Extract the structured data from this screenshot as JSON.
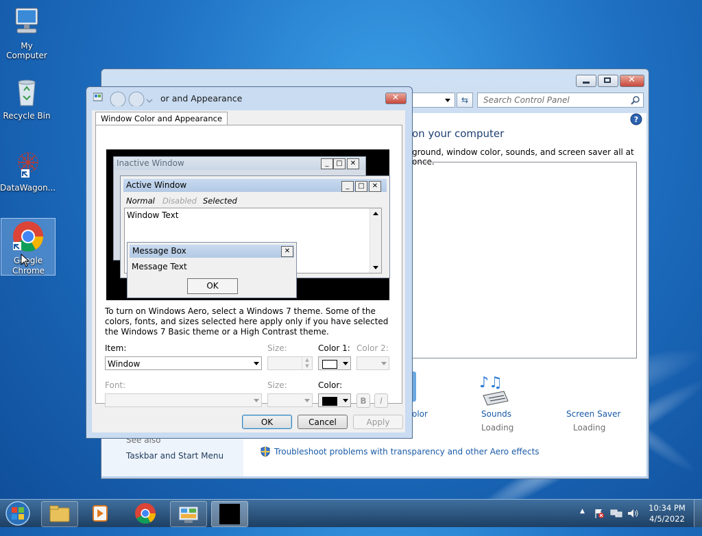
{
  "desktop": {
    "icons": [
      {
        "label": "My Computer"
      },
      {
        "label": "Recycle Bin"
      },
      {
        "label": "DataWagon..."
      },
      {
        "label": "Google Chrome"
      }
    ]
  },
  "control_panel": {
    "search_placeholder": "Search Control Panel",
    "heading_fragment": "on your computer",
    "description_fragment": "ground, window color, sounds, and screen saver all at once.",
    "color_fragment": "olor",
    "sounds_label": "Sounds",
    "sounds_status": "Loading",
    "screensaver_label": "Screen Saver",
    "screensaver_status": "Loading",
    "see_also": "See also",
    "taskbar_link": "Taskbar and Start Menu",
    "troubleshoot_link": "Troubleshoot problems with transparency and other Aero effects"
  },
  "dialog": {
    "title": "Window Color and Appearance",
    "title_visible": "or and Appearance",
    "tab_label": "Window Color and Appearance",
    "preview": {
      "inactive_title": "Inactive Window",
      "active_title": "Active Window",
      "menu_normal": "Normal",
      "menu_disabled": "Disabled",
      "menu_selected": "Selected",
      "window_text": "Window Text",
      "msgbox_title": "Message Box",
      "msgbox_text": "Message Text",
      "msgbox_ok": "OK"
    },
    "info_text": "To turn on Windows Aero, select a Windows 7 theme.  Some of the colors, fonts, and sizes selected here apply only if you have selected the Windows 7 Basic theme or a High Contrast theme.",
    "item_label": "Item:",
    "item_value": "Window",
    "size_label": "Size:",
    "color1_label": "Color 1:",
    "color2_label": "Color 2:",
    "font_label": "Font:",
    "font_size_label": "Size:",
    "color_label": "Color:",
    "bold_label": "B",
    "italic_label": "I",
    "ok_label": "OK",
    "cancel_label": "Cancel",
    "apply_label": "Apply",
    "color1_value": "#ffffff",
    "font_color_value": "#000000"
  },
  "taskbar": {
    "time": "10:34 PM",
    "date": "4/5/2022"
  },
  "colors": {
    "title_active": "#c2d5ee",
    "title_inactive": "#d6e0ec",
    "link": "#1a5aa6"
  }
}
